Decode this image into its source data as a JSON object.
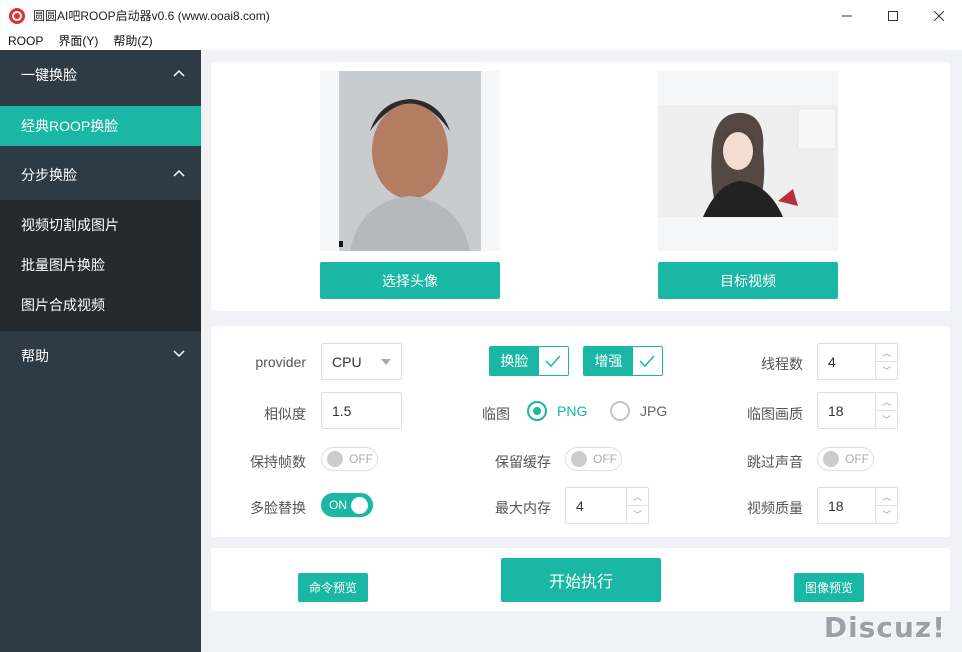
{
  "window": {
    "title": "圆圆AI吧ROOP启动器v0.6 (www.ooai8.com)"
  },
  "menu": [
    "ROOP",
    "界面(Y)",
    "帮助(Z)"
  ],
  "sidebar": {
    "group1": "一键换脸",
    "active_item": "经典ROOP换脸",
    "group2": "分步换脸",
    "sub_items": [
      "视频切割成图片",
      "批量图片换脸",
      "图片合成视频"
    ],
    "group3": "帮助"
  },
  "images": {
    "select_avatar_btn": "选择头像",
    "target_video_btn": "目标视频"
  },
  "settings": {
    "provider_label": "provider",
    "provider_value": "CPU",
    "face_swap_check": "换脸",
    "enhance_check": "增强",
    "threads_label": "线程数",
    "threads_value": "4",
    "similarity_label": "相似度",
    "similarity_value": "1.5",
    "temp_image_label": "临图",
    "png_label": "PNG",
    "jpg_label": "JPG",
    "temp_quality_label": "临图画质",
    "temp_quality_value": "18",
    "keep_fps_label": "保持帧数",
    "keep_fps_state": "OFF",
    "keep_cache_label": "保留缓存",
    "keep_cache_state": "OFF",
    "skip_audio_label": "跳过声音",
    "skip_audio_state": "OFF",
    "multi_face_label": "多脸替换",
    "multi_face_state": "ON",
    "max_memory_label": "最大内存",
    "max_memory_value": "4",
    "video_quality_label": "视频质量",
    "video_quality_value": "18"
  },
  "actions": {
    "cmd_preview": "命令预览",
    "start": "开始执行",
    "image_preview": "图像预览"
  },
  "watermark": "Discuz!",
  "colors": {
    "accent": "#19b7a4",
    "sidebar_bg": "#2f3b44",
    "sidebar_sub_bg": "#232b31"
  }
}
